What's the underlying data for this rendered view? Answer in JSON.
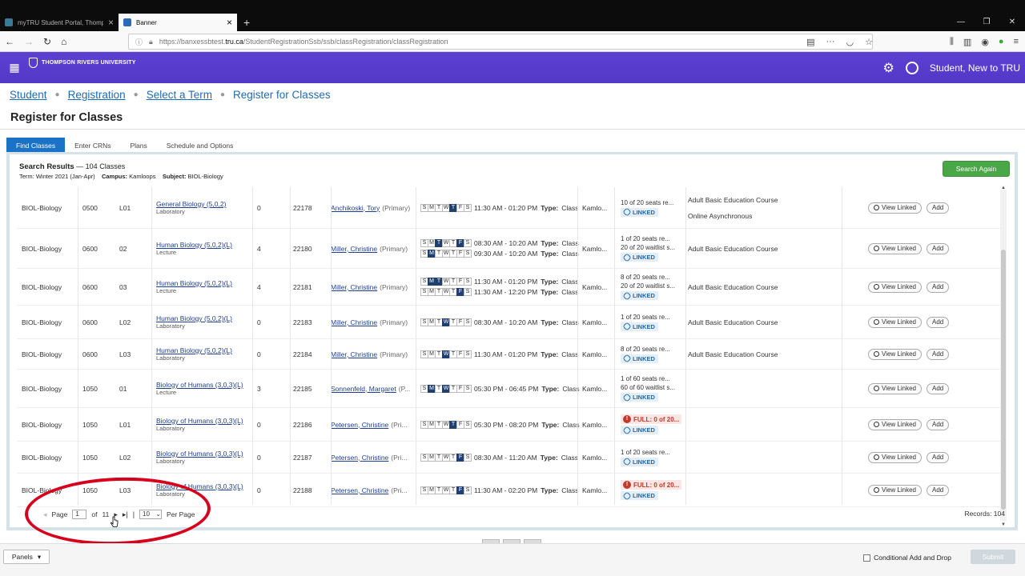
{
  "browser": {
    "tabs": [
      {
        "title": "myTRU Student Portal, Thomps..."
      },
      {
        "title": "Banner"
      }
    ],
    "url_prefix": "https://banxessbtest.",
    "url_domain": "tru.ca",
    "url_path": "/StudentRegistrationSsb/ssb/classRegistration/classRegistration"
  },
  "header": {
    "logo_text": "THOMPSON RIVERS UNIVERSITY",
    "user_name": "Student, New to TRU"
  },
  "breadcrumb": [
    "Student",
    "Registration",
    "Select a Term",
    "Register for Classes"
  ],
  "page_title": "Register for Classes",
  "tabs": [
    "Find Classes",
    "Enter CRNs",
    "Plans",
    "Schedule and Options"
  ],
  "search": {
    "title": "Search Results",
    "count": "— 104 Classes",
    "term_label": "Term:",
    "term": "Winter 2021 (Jan-Apr)",
    "campus_label": "Campus:",
    "campus": "Kamloops",
    "subject_label": "Subject:",
    "subject": "BIOL-Biology",
    "search_again": "Search Again"
  },
  "rows": [
    {
      "subj": "BIOL-Biology",
      "course": "0500",
      "sec": "L01",
      "title": "General Biology (5,0,2)",
      "type": "Laboratory",
      "hrs": "0",
      "crn": "22178",
      "inst": "Anchikoski, Tory",
      "role": "(Primary)",
      "meet": [
        {
          "days": [
            0,
            0,
            0,
            0,
            1,
            0,
            0
          ],
          "time": "11:30 AM - 01:20 PM",
          "type": "Class"
        }
      ],
      "campus": "Kamlo...",
      "seats": [
        "10 of 20 seats re..."
      ],
      "full": "",
      "attr": [
        "Adult Basic Education Course",
        "Online Asynchronous"
      ]
    },
    {
      "subj": "BIOL-Biology",
      "course": "0600",
      "sec": "02",
      "title": "Human Biology (5,0,2)(L)",
      "type": "Lecture",
      "hrs": "4",
      "crn": "22180",
      "inst": "Miller, Christine",
      "role": "(Primary)",
      "meet": [
        {
          "days": [
            0,
            0,
            1,
            0,
            0,
            1,
            0
          ],
          "time": "08:30 AM - 10:20 AM",
          "type": "Class"
        },
        {
          "days": [
            0,
            1,
            0,
            0,
            0,
            0,
            0
          ],
          "time": "09:30 AM - 10:20 AM",
          "type": "Class"
        }
      ],
      "campus": "Kamlo...",
      "seats": [
        "1 of 20 seats re...",
        "20 of 20 waitlist s..."
      ],
      "full": "",
      "attr": [
        "Adult Basic Education Course"
      ]
    },
    {
      "subj": "BIOL-Biology",
      "course": "0600",
      "sec": "03",
      "title": "Human Biology (5,0,2)(L)",
      "type": "Lecture",
      "hrs": "4",
      "crn": "22181",
      "inst": "Miller, Christine",
      "role": "(Primary)",
      "meet": [
        {
          "days": [
            0,
            1,
            1,
            0,
            0,
            0,
            0
          ],
          "time": "11:30 AM - 01:20 PM",
          "type": "Class"
        },
        {
          "days": [
            0,
            0,
            0,
            0,
            0,
            1,
            0
          ],
          "time": "11:30 AM - 12:20 PM",
          "type": "Class"
        }
      ],
      "campus": "Kamlo...",
      "seats": [
        "8 of 20 seats re...",
        "20 of 20 waitlist s..."
      ],
      "full": "",
      "attr": [
        "Adult Basic Education Course"
      ]
    },
    {
      "subj": "BIOL-Biology",
      "course": "0600",
      "sec": "L02",
      "title": "Human Biology (5,0,2)(L)",
      "type": "Laboratory",
      "hrs": "0",
      "crn": "22183",
      "inst": "Miller, Christine",
      "role": "(Primary)",
      "meet": [
        {
          "days": [
            0,
            0,
            0,
            1,
            0,
            0,
            0
          ],
          "time": "08:30 AM - 10:20 AM",
          "type": "Class"
        }
      ],
      "campus": "Kamlo...",
      "seats": [
        "1 of 20 seats re..."
      ],
      "full": "",
      "attr": [
        "Adult Basic Education Course"
      ]
    },
    {
      "subj": "BIOL-Biology",
      "course": "0600",
      "sec": "L03",
      "title": "Human Biology (5,0,2)(L)",
      "type": "Laboratory",
      "hrs": "0",
      "crn": "22184",
      "inst": "Miller, Christine",
      "role": "(Primary)",
      "meet": [
        {
          "days": [
            0,
            0,
            0,
            1,
            0,
            0,
            0
          ],
          "time": "11:30 AM - 01:20 PM",
          "type": "Class"
        }
      ],
      "campus": "Kamlo...",
      "seats": [
        "8 of 20 seats re..."
      ],
      "full": "",
      "attr": [
        "Adult Basic Education Course"
      ]
    },
    {
      "subj": "BIOL-Biology",
      "course": "1050",
      "sec": "01",
      "title": "Biology of Humans (3,0,3)(L)",
      "type": "Lecture",
      "hrs": "3",
      "crn": "22185",
      "inst": "Sonnenfeld, Margaret",
      "role": "(P...",
      "meet": [
        {
          "days": [
            0,
            1,
            0,
            1,
            0,
            0,
            0
          ],
          "time": "05:30 PM - 06:45 PM",
          "type": "Class"
        }
      ],
      "campus": "Kamlo...",
      "seats": [
        "1 of 60 seats re...",
        "60 of 60 waitlist s..."
      ],
      "full": "",
      "attr": []
    },
    {
      "subj": "BIOL-Biology",
      "course": "1050",
      "sec": "L01",
      "title": "Biology of Humans (3,0,3)(L)",
      "type": "Laboratory",
      "hrs": "0",
      "crn": "22186",
      "inst": "Petersen, Christine",
      "role": "(Pri...",
      "meet": [
        {
          "days": [
            0,
            0,
            0,
            0,
            1,
            0,
            0
          ],
          "time": "05:30 PM - 08:20 PM",
          "type": "Class"
        }
      ],
      "campus": "Kamlo...",
      "seats": [],
      "full": "FULL: 0 of 20...",
      "attr": []
    },
    {
      "subj": "BIOL-Biology",
      "course": "1050",
      "sec": "L02",
      "title": "Biology of Humans (3,0,3)(L)",
      "type": "Laboratory",
      "hrs": "0",
      "crn": "22187",
      "inst": "Petersen, Christine",
      "role": "(Pri...",
      "meet": [
        {
          "days": [
            0,
            0,
            0,
            0,
            0,
            1,
            0
          ],
          "time": "08:30 AM - 11:20 AM",
          "type": "Class"
        }
      ],
      "campus": "Kamlo...",
      "seats": [
        "1 of 20 seats re..."
      ],
      "full": "",
      "attr": []
    },
    {
      "subj": "BIOL-Biology",
      "course": "1050",
      "sec": "L03",
      "title": "Biology of Humans (3,0,3)(L)",
      "type": "Laboratory",
      "hrs": "0",
      "crn": "22188",
      "inst": "Petersen, Christine",
      "role": "(Pri...",
      "meet": [
        {
          "days": [
            0,
            0,
            0,
            0,
            0,
            1,
            0
          ],
          "time": "11:30 AM - 02:20 PM",
          "type": "Class"
        }
      ],
      "campus": "Kamlo...",
      "seats": [],
      "full": "FULL: 0 of 20...",
      "attr": []
    }
  ],
  "day_letters": [
    "S",
    "M",
    "T",
    "W",
    "T",
    "F",
    "S"
  ],
  "type_label": "Type:",
  "linked_label": "LINKED",
  "view_linked_label": "View Linked",
  "add_label": "Add",
  "pager": {
    "page_label": "Page",
    "page": "1",
    "of_label": "of",
    "total_pages": "11",
    "per_page": "10",
    "per_page_label": "Per Page"
  },
  "records": "Records: 104",
  "bottom": {
    "panels": "Panels",
    "conditional": "Conditional Add and Drop",
    "submit": "Submit"
  },
  "colors": {
    "header": "#5a3fd1",
    "tab_active": "#1a73c6",
    "search_again": "#4aa747",
    "annotation_circle": "#d6001c"
  }
}
